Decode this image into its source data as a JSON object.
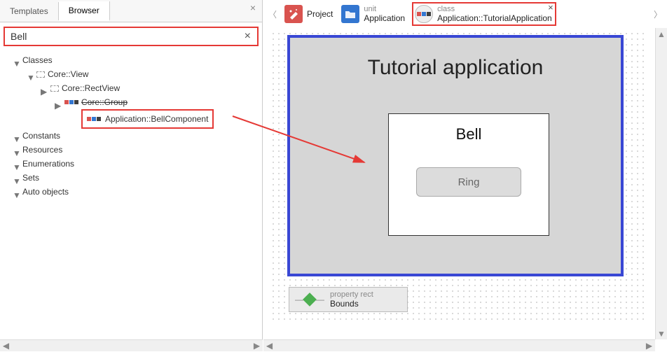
{
  "tabs": {
    "templates": "Templates",
    "browser": "Browser"
  },
  "search": {
    "value": "Bell"
  },
  "tree": {
    "classes": "Classes",
    "core_view": "Core::View",
    "core_rectview": "Core::RectView",
    "core_group": "Core::Group",
    "bell_component": "Application::BellComponent",
    "constants": "Constants",
    "resources": "Resources",
    "enumerations": "Enumerations",
    "sets": "Sets",
    "auto_objects": "Auto objects"
  },
  "breadcrumb": {
    "project": "Project",
    "unit_sup": "unit",
    "unit": "Application",
    "class_sup": "class",
    "class": "Application::TutorialApplication"
  },
  "canvas": {
    "title": "Tutorial application",
    "bell_label": "Bell",
    "ring_label": "Ring"
  },
  "bounds": {
    "sup": "property rect",
    "name": "Bounds"
  }
}
